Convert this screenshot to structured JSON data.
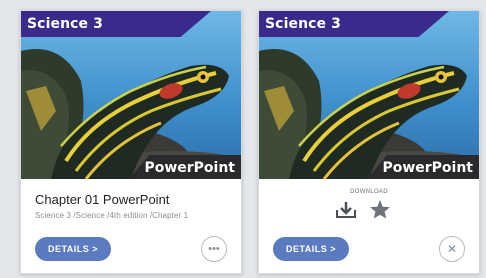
{
  "cards": [
    {
      "subject": "Science 3",
      "type": "PowerPoint",
      "title": "Chapter 01 PowerPoint",
      "breadcrumb": "Science 3 /Science /4th edition /Chapter 1",
      "details_label": "DETAILS >",
      "menu_icon": "more-horizontal-icon"
    },
    {
      "subject": "Science 3",
      "type": "PowerPoint",
      "download_label": "DOWNLOAD",
      "details_label": "DETAILS >",
      "download_icon": "download-icon",
      "favorite_icon": "star-icon",
      "close_icon": "close-icon"
    }
  ],
  "colors": {
    "subject_banner": "#3b2a8c",
    "type_banner": "#2a2a2c",
    "button": "#5a7bc0",
    "background": "#e3e6ea"
  }
}
